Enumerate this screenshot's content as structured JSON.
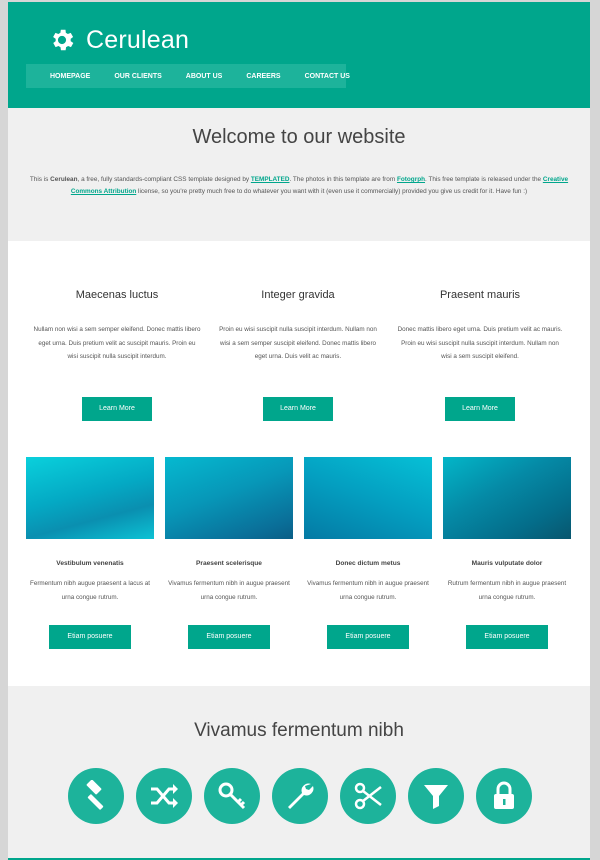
{
  "brand": {
    "name": "Cerulean",
    "icon": "gear-icon"
  },
  "nav": {
    "items": [
      "HOMEPAGE",
      "OUR CLIENTS",
      "ABOUT US",
      "CAREERS",
      "CONTACT US"
    ]
  },
  "welcome": {
    "title": "Welcome to our website",
    "text_1": "This is ",
    "brand": "Cerulean",
    "text_2": ", a free, fully standards-compliant CSS template designed by ",
    "link_templated": "TEMPLATED",
    "text_3": ". The photos in this template are from ",
    "link_fotogrph": "Fotogrph",
    "text_4": ". This free template is released under the ",
    "link_license": "Creative Commons Attribution",
    "text_5": " license, so you're pretty much free to do whatever you want with it (even use it commercially) provided you give us credit for it. Have fun :)"
  },
  "features": [
    {
      "title": "Maecenas luctus",
      "text": "Nullam non wisi a sem semper eleifend. Donec mattis libero eget urna. Duis pretium velit ac suscipit mauris. Proin eu wisi suscipit nulla suscipit interdum.",
      "button": "Learn More"
    },
    {
      "title": "Integer gravida",
      "text": "Proin eu wisi suscipit nulla suscipit interdum. Nullam non wisi a sem semper suscipit eleifend. Donec mattis libero eget urna. Duis velit ac mauris.",
      "button": "Learn More"
    },
    {
      "title": "Praesent mauris",
      "text": "Donec mattis libero eget urna. Duis pretium velit ac mauris. Proin eu wisi suscipit nulla suscipit interdum. Nullam non wisi a sem suscipit eleifend.",
      "button": "Learn More"
    }
  ],
  "gallery": [
    {
      "title": "Vestibulum venenatis",
      "text": "Fermentum nibh augue praesent a lacus at urna congue rutrum.",
      "button": "Etiam posuere"
    },
    {
      "title": "Praesent scelerisque",
      "text": "Vivamus fermentum nibh in augue praesent urna congue rutrum.",
      "button": "Etiam posuere"
    },
    {
      "title": "Donec dictum metus",
      "text": "Vivamus fermentum nibh in augue praesent urna congue rutrum.",
      "button": "Etiam posuere"
    },
    {
      "title": "Mauris vulputate dolor",
      "text": "Rutrum fermentum nibh in augue praesent urna congue rutrum.",
      "button": "Etiam posuere"
    }
  ],
  "tools": {
    "title": "Vivamus fermentum nibh",
    "icons": [
      "gavel-icon",
      "shuffle-icon",
      "key-icon",
      "wrench-icon",
      "scissors-icon",
      "filter-icon",
      "lock-icon"
    ]
  },
  "colors": {
    "accent": "#00a68c",
    "accent_light": "#1db39b",
    "section_bg": "#f0f0f0"
  }
}
